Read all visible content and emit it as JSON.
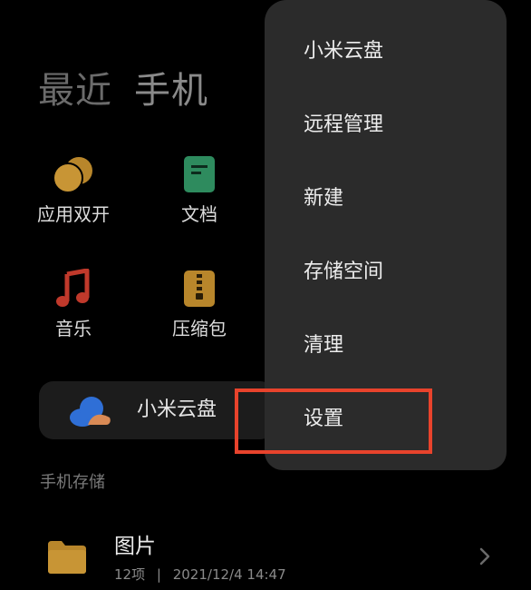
{
  "tabs": [
    {
      "label": "最近"
    },
    {
      "label": "手机"
    }
  ],
  "shortcuts": [
    {
      "label": "应用双开",
      "icon": "dual-apps-icon",
      "color": "#b8862b"
    },
    {
      "label": "文档",
      "icon": "document-icon",
      "color": "#2e8b5e"
    },
    {
      "label": "音乐",
      "icon": "music-note-icon",
      "color": "#c0392b"
    },
    {
      "label": "压缩包",
      "icon": "zip-archive-icon",
      "color": "#b8862b"
    }
  ],
  "cloud_card": {
    "label": "小米云盘",
    "icon": "cloud-icon",
    "colors": {
      "blue": "#2f6fd6",
      "orange": "#d98a55"
    }
  },
  "section": {
    "title": "手机存储"
  },
  "folders": [
    {
      "name": "图片",
      "count": "12项",
      "separator": "|",
      "date": "2021/12/4 14:47",
      "icon": "folder-icon",
      "color": "#b8862b"
    }
  ],
  "menu": {
    "items": [
      {
        "label": "小米云盘"
      },
      {
        "label": "远程管理"
      },
      {
        "label": "新建"
      },
      {
        "label": "存储空间"
      },
      {
        "label": "清理"
      },
      {
        "label": "设置"
      }
    ],
    "highlighted_index": 5,
    "highlight_color": "#e8432c"
  }
}
